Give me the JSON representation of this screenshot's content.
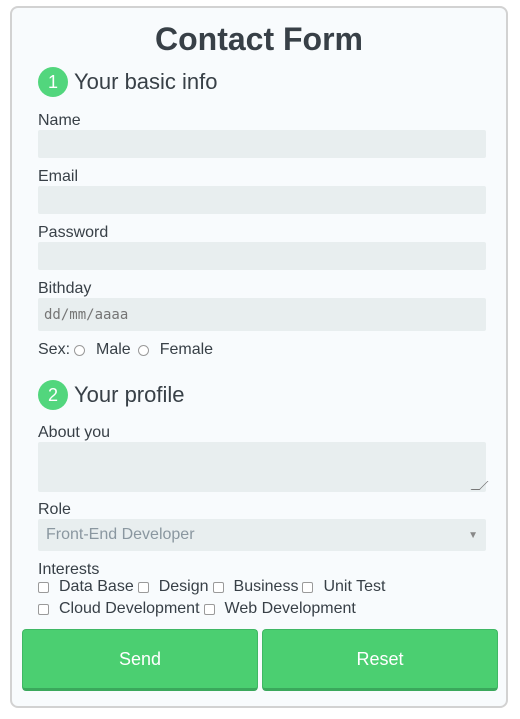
{
  "form": {
    "title": "Contact Form",
    "section1": {
      "number": "1",
      "title": "Your basic info"
    },
    "name_label": "Name",
    "email_label": "Email",
    "password_label": "Password",
    "birthday_label": "Bithday",
    "birthday_placeholder": "dd/mm/aaaa",
    "sex_label": "Sex:",
    "sex_options": [
      "Male",
      "Female"
    ],
    "section2": {
      "number": "2",
      "title": "Your profile"
    },
    "about_label": "About you",
    "role_label": "Role",
    "role_selected": "Front-End Developer",
    "interests_label": "Interests",
    "interests": [
      "Data Base",
      "Design",
      "Business",
      "Unit Test",
      "Cloud Development",
      "Web Development"
    ],
    "send_label": "Send",
    "reset_label": "Reset"
  },
  "colors": {
    "accent": "#4bcf71",
    "field_bg": "#e8eeef",
    "text": "#384047"
  }
}
